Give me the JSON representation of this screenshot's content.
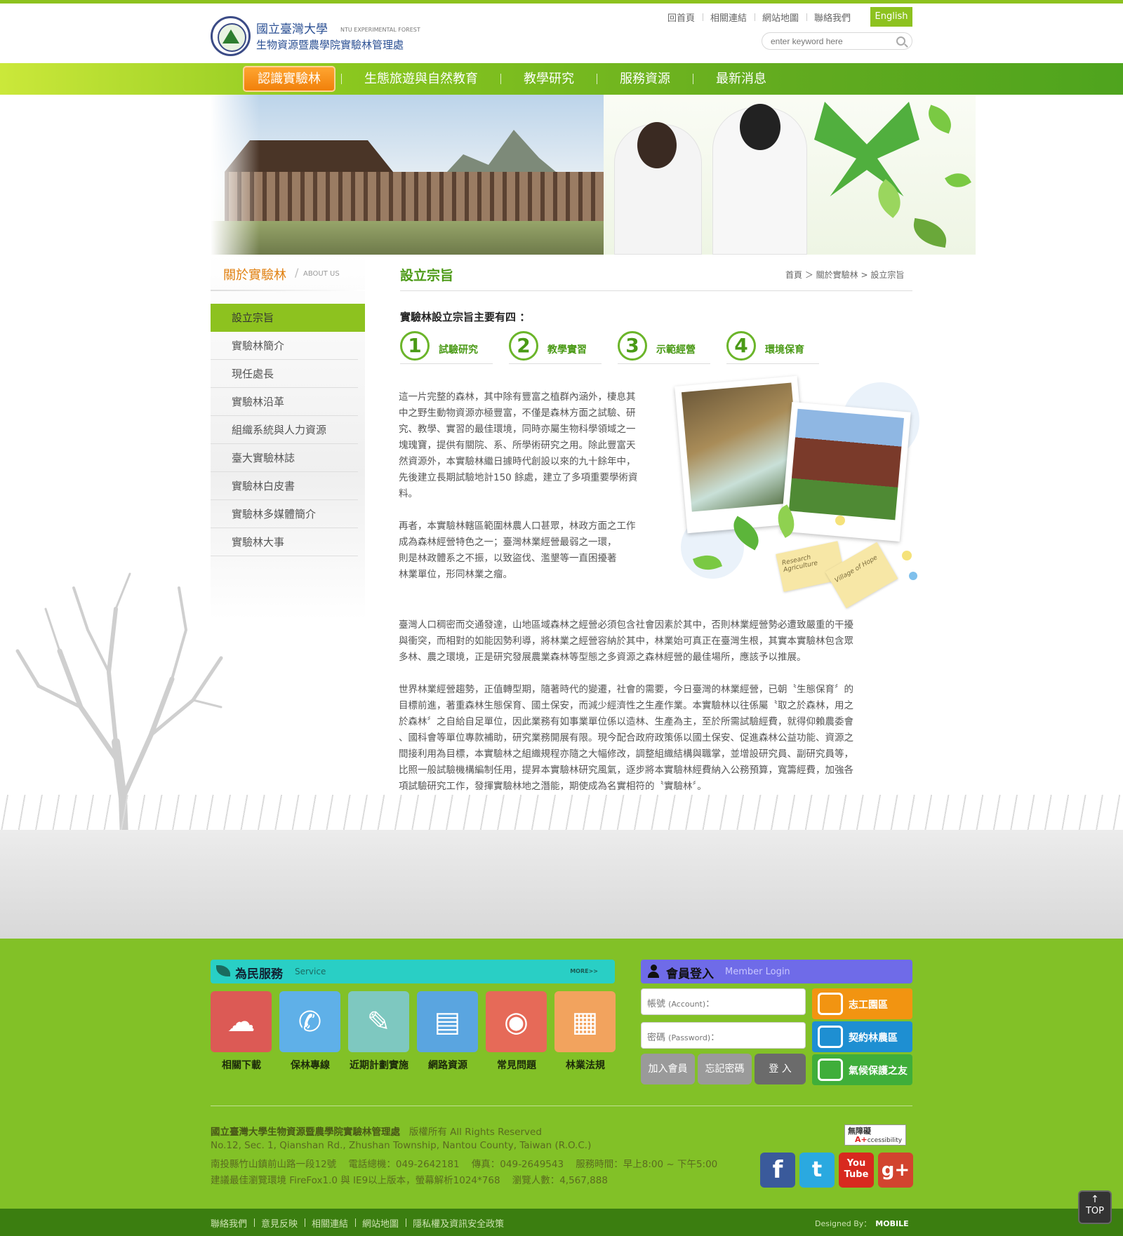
{
  "header": {
    "logo_line1": "國立臺灣大學",
    "logo_line1_en": "NTU EXPERIMENTAL FOREST",
    "logo_line2": "生物資源暨農學院實驗林管理處",
    "top_links": [
      "回首頁",
      "相關連結",
      "網站地圖",
      "聯絡我們"
    ],
    "english": "English",
    "search_placeholder": "enter keyword here"
  },
  "nav": {
    "items": [
      "認識實驗林",
      "生態旅遊與自然教育",
      "教學研究",
      "服務資源",
      "最新消息"
    ],
    "active": "認識實驗林"
  },
  "sidebar": {
    "title": "關於實驗林",
    "subtitle": "ABOUT US",
    "items": [
      "設立宗旨",
      "實驗林簡介",
      "現任處長",
      "實驗林沿革",
      "組織系統與人力資源",
      "臺大實驗林誌",
      "實驗林白皮書",
      "實驗林多媒體簡介",
      "實驗林大事"
    ],
    "active": "設立宗旨"
  },
  "main": {
    "title": "設立宗旨",
    "breadcrumb": "首頁 ＞ 關於實驗林 > 設立宗旨",
    "lead": "實驗林設立宗旨主要有四 ：",
    "purposes": [
      {
        "num": "1",
        "label": "試驗研究"
      },
      {
        "num": "2",
        "label": "教學實習"
      },
      {
        "num": "3",
        "label": "示範經營"
      },
      {
        "num": "4",
        "label": "環境保育"
      }
    ],
    "para1_lines": [
      "這一片完整的森林，其中除有豐富之植群內涵外，棲息其",
      "中之野生動物資源亦極豐富，不僅是森林方面之試驗、研",
      "究、教學、實習的最佳環境，同時亦屬生物科學領域之一",
      "塊瑰寶，提供有關院、系、所學術研究之用。除此豐富天",
      "然資源外，本實驗林繼日據時代創設以來的九十餘年中，",
      "先後建立長期試驗地計150 餘處，建立了多項重要學術資",
      "料。"
    ],
    "para2_lines": [
      "再者，本實驗林轄區範圍林農人口甚眾，林政方面之工作",
      "成為森林經營特色之一；臺灣林業經營最弱之一環，",
      "則是林政體系之不振，以致盜伐、濫墾等一直困擾著",
      "林業單位，形同林業之瘤。"
    ],
    "para3_lines": [
      "臺灣人口稠密而交通發達，山地區域森林之經營必須包含社會因素於其中，否則林業經營勢必遭致嚴重的干擾",
      "與衝突，而相對的如能因勢利導，將林業之經營容納於其中，林業始可真正在臺灣生根，其實本實驗林包含眾",
      "多林、農之環境，正是研究發展農業森林等型態之多資源之森林經營的最佳場所，應該予以推展。"
    ],
    "para4_lines": [
      "世界林業經營趨勢，正值轉型期，隨著時代的變遷，社會的需要，今日臺灣的林業經營，已朝〝生態保育〞的",
      "目標前進，著重森林生態保育、國土保安，而減少經濟性之生產作業。本實驗林以往係屬〝取之於森林，用之",
      "於森林〞之自給自足單位，因此業務有如事業單位係以造林、生產為主，至於所需試驗經費，就得仰賴農委會",
      "、國科會等單位專款補助，研究業務開展有限。現今配合政府政策係以國土保安、促進森林公益功能、資源之",
      "間接利用為目標，本實驗林之組織規程亦隨之大幅修改，調整組織結構與職掌，並增設研究員、副研究員等，",
      "比照一般試驗機構編制任用，提昇本實驗林研究風氣，逐步將本實驗林經費納入公務預算，寬籌經費，加強各",
      "項試驗研究工作，發揮實驗林地之潛能，期使成為名實相符的〝實驗林〞。"
    ],
    "note1": "Research Agriculture",
    "note2": "Village of Hope"
  },
  "service": {
    "title": "為民服務",
    "subtitle": "Service",
    "more": "MORE>>",
    "tiles": [
      {
        "label": "相關下載",
        "color": "#dc5a55",
        "icon": "download-icon"
      },
      {
        "label": "保林專線",
        "color": "#5fb0e8",
        "icon": "phone-icon"
      },
      {
        "label": "近期計劃實施",
        "color": "#7ec8c0",
        "icon": "edit-icon"
      },
      {
        "label": "網路資源",
        "color": "#5aa5e0",
        "icon": "browser-icon"
      },
      {
        "label": "常見問題",
        "color": "#e66a58",
        "icon": "bulb-icon"
      },
      {
        "label": "林業法規",
        "color": "#f2a35e",
        "icon": "document-icon"
      }
    ]
  },
  "member": {
    "title": "會員登入",
    "subtitle": "Member Login",
    "account_label": "帳號",
    "account_hint": "(Account)",
    "password_label": "密碼",
    "password_hint": "(Password)",
    "join": "加入會員",
    "forgot": "忘記密碼",
    "login": "登 入",
    "links": [
      {
        "label": "志工園區",
        "color": "#f29411"
      },
      {
        "label": "契約林農區",
        "color": "#1e8fd2"
      },
      {
        "label": "氣候保護之友",
        "color": "#3fae3a"
      }
    ]
  },
  "footer": {
    "org": "國立臺灣大學生物資源暨農學院實驗林管理處",
    "rights": "版權所有 All Rights Reserved",
    "address_en": "No.12, Sec. 1, Qianshan Rd., Zhushan Township, Nantou County, Taiwan (R.O.C.)",
    "address_zh": "南投縣竹山鎮前山路一段12號",
    "phone": "電話總機：049-2642181",
    "fax": "傳真：049-2649543",
    "hours": "服務時間：早上8:00 ~ 下午5:00",
    "browser": "建議最佳瀏覽環境 FireFox1.0 與 IE9以上版本，螢幕解析1024*768",
    "visitors": "瀏覽人數：4,567,888",
    "access_line1": "無障礙",
    "access_line2": "ccessibility",
    "access_a": "A+",
    "social": [
      {
        "label": "f",
        "color": "#3a5a9b",
        "icon": "facebook-icon"
      },
      {
        "label": "t",
        "color": "#2aa9e0",
        "icon": "twitter-icon"
      },
      {
        "label": "You Tube",
        "color": "#d8291f",
        "icon": "youtube-icon"
      },
      {
        "label": "g+",
        "color": "#d2442f",
        "icon": "google-plus-icon"
      }
    ],
    "bottom_links": [
      "聯絡我們",
      "意見反映",
      "相關連結",
      "網站地圖",
      "隱私權及資訊安全政策"
    ],
    "designed_by": "Designed By：",
    "designer": "MOBILE",
    "top": "TOP",
    "top_arrow": "↑"
  }
}
